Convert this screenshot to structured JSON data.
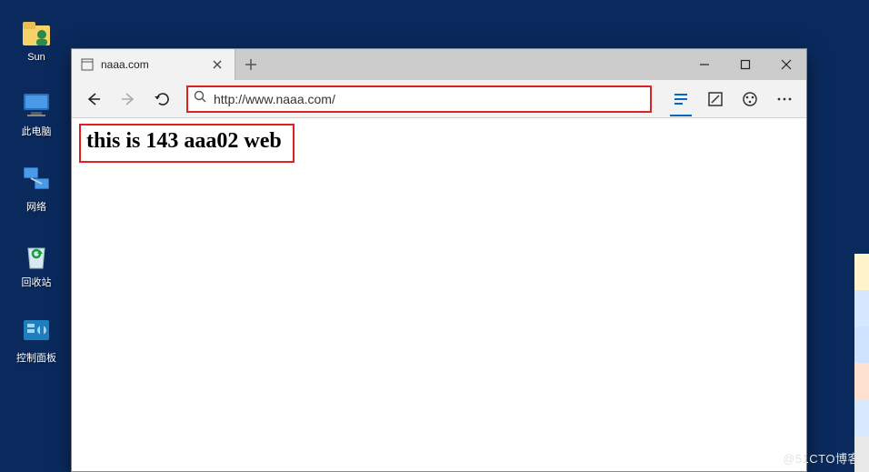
{
  "desktop": {
    "icons": [
      {
        "name": "sun-user",
        "label": "Sun"
      },
      {
        "name": "this-pc",
        "label": "此电脑"
      },
      {
        "name": "network",
        "label": "网络"
      },
      {
        "name": "recycle-bin",
        "label": "回收站"
      },
      {
        "name": "control-panel",
        "label": "控制面板"
      }
    ]
  },
  "browser": {
    "tab_title": "naaa.com",
    "address": "http://www.naaa.com/",
    "page_heading": "this is 143 aaa02 web"
  },
  "watermark": "@51CTO博客"
}
